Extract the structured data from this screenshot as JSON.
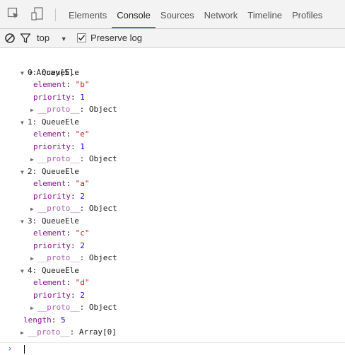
{
  "toolbar": {
    "inspect_icon": "inspect-element-icon",
    "device_icon": "device-mode-icon",
    "tabs": [
      {
        "label": "Elements",
        "active": false
      },
      {
        "label": "Console",
        "active": true
      },
      {
        "label": "Sources",
        "active": false
      },
      {
        "label": "Network",
        "active": false
      },
      {
        "label": "Timeline",
        "active": false
      },
      {
        "label": "Profiles",
        "active": false
      }
    ]
  },
  "filterbar": {
    "clear_icon": "clear-console-icon",
    "filter_icon": "filter-icon",
    "context": "top",
    "preserve_log_label": "Preserve log",
    "preserve_log_checked": true
  },
  "console": {
    "array_label": "Array[5]",
    "items": [
      {
        "header": "0: QueueEle",
        "element": "\"b\"",
        "priority": "1"
      },
      {
        "header": "1: QueueEle",
        "element": "\"e\"",
        "priority": "1"
      },
      {
        "header": "2: QueueEle",
        "element": "\"a\"",
        "priority": "2"
      },
      {
        "header": "3: QueueEle",
        "element": "\"c\"",
        "priority": "2"
      },
      {
        "header": "4: QueueEle",
        "element": "\"d\"",
        "priority": "2"
      }
    ],
    "element_key": "element",
    "priority_key": "priority",
    "proto_key": "__proto__",
    "object_proto_value": "Object",
    "length_key": "length",
    "length_value": "5",
    "array_proto_value": "Array[0]"
  },
  "prompt": {
    "symbol": "›"
  },
  "colors": {
    "accent": "#3879d9",
    "key": "#881391",
    "string": "#c41a16",
    "number": "#1c00cf"
  }
}
